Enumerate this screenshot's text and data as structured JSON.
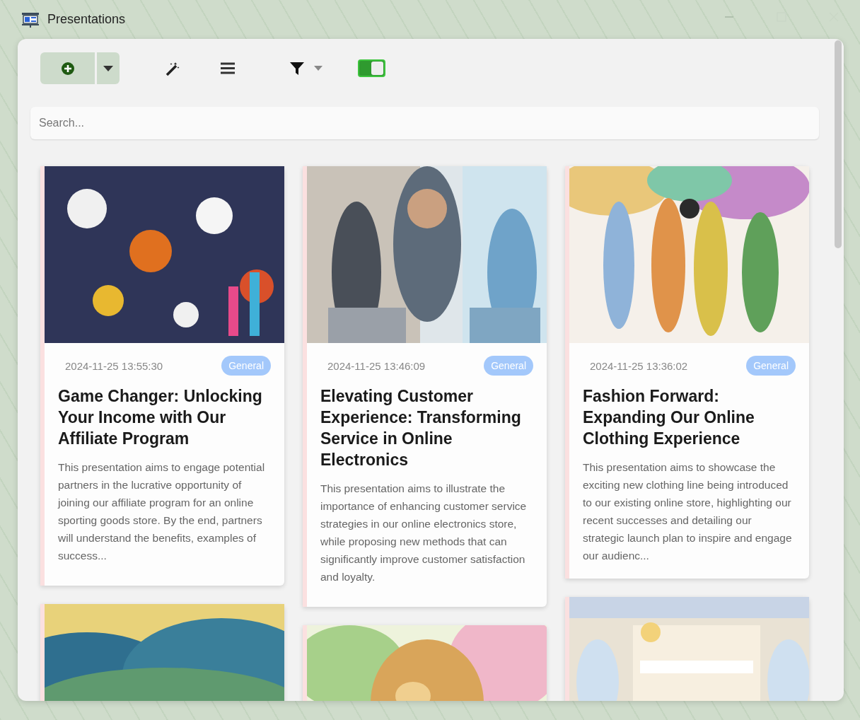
{
  "window": {
    "title": "Presentations"
  },
  "toolbar": {
    "view_toggle": {
      "on": true
    }
  },
  "search": {
    "placeholder": "Search..."
  },
  "columns": [
    {
      "cards": [
        {
          "kind": "full",
          "date": "2024-11-25 13:55:30",
          "tag": "General",
          "title": "Game Changer: Unlocking Your Income with Our Affiliate Program",
          "description": "This presentation aims to engage potential partners in the lucrative opportunity of joining our affiliate program for an online sporting goods store. By the end, partners will understand the benefits, examples of success..."
        },
        {
          "kind": "picture"
        }
      ]
    },
    {
      "cards": [
        {
          "kind": "full",
          "date": "2024-11-25 13:46:09",
          "tag": "General",
          "title": "Elevating Customer Experience: Transforming Service in Online Electronics",
          "description": "This presentation aims to illustrate the importance of enhancing customer service strategies in our online electronics store, while proposing new methods that can significantly improve customer satisfaction and loyalty."
        },
        {
          "kind": "picture"
        }
      ]
    },
    {
      "cards": [
        {
          "kind": "full",
          "date": "2024-11-25 13:36:02",
          "tag": "General",
          "title": "Fashion Forward: Expanding Our Online Clothing Experience",
          "description": "This presentation aims to showcase the exciting new clothing line being introduced to our existing online store, highlighting our recent successes and detailing our strategic launch plan to inspire and engage our audienc..."
        },
        {
          "kind": "picture"
        }
      ]
    }
  ]
}
